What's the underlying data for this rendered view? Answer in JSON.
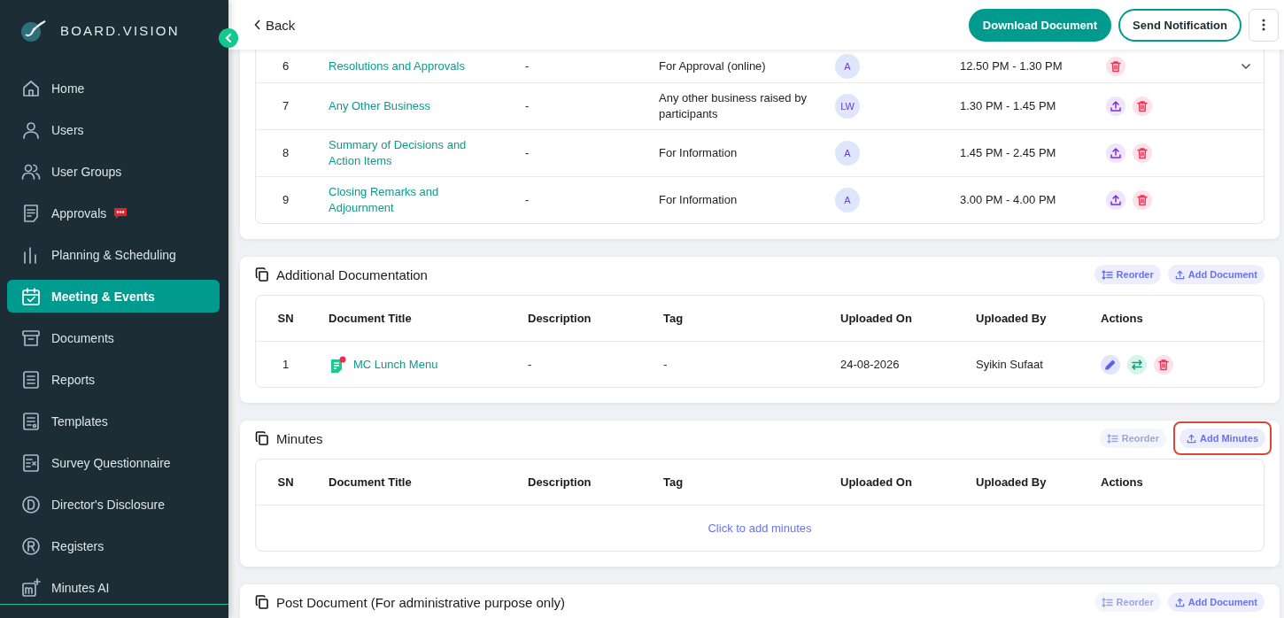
{
  "sidebar": {
    "brand": "BOARD.VISION",
    "items": [
      {
        "label": "Home",
        "kind": "home",
        "selected": false,
        "badge": false
      },
      {
        "label": "Users",
        "kind": "user",
        "selected": false,
        "badge": false
      },
      {
        "label": "User Groups",
        "kind": "users",
        "selected": false,
        "badge": false
      },
      {
        "label": "Approvals",
        "kind": "doc",
        "selected": false,
        "badge": true
      },
      {
        "label": "Planning & Scheduling",
        "kind": "bars",
        "selected": false,
        "badge": false
      },
      {
        "label": "Meeting & Events",
        "kind": "calendar",
        "selected": true,
        "badge": false
      },
      {
        "label": "Documents",
        "kind": "archive",
        "selected": false,
        "badge": false
      },
      {
        "label": "Reports",
        "kind": "list",
        "selected": false,
        "badge": false
      },
      {
        "label": "Templates",
        "kind": "template",
        "selected": false,
        "badge": false
      },
      {
        "label": "Survey Questionnaire",
        "kind": "survey",
        "selected": false,
        "badge": false
      },
      {
        "label": "Director's Disclosure",
        "kind": "circle-d",
        "selected": false,
        "badge": false
      },
      {
        "label": "Registers",
        "kind": "circle-r",
        "selected": false,
        "badge": false
      },
      {
        "label": "Minutes AI",
        "kind": "ai",
        "selected": false,
        "badge": false
      }
    ]
  },
  "header": {
    "back": "Back",
    "buttons": [
      {
        "label": "Download Document",
        "kind": "primary"
      },
      {
        "label": "Send Notification",
        "kind": "outline"
      }
    ]
  },
  "agenda": {
    "rows": [
      {
        "sn": "6",
        "title": "Resolutions and Approvals",
        "presenter": "-",
        "purpose": "For Approval (online)",
        "avatar": "A",
        "time": "12.50 PM - 1.30 PM",
        "actions": [
          {
            "kind": "delete"
          }
        ],
        "expandable": true
      },
      {
        "sn": "7",
        "title": "Any Other Business",
        "presenter": "-",
        "purpose": "Any other business raised by participants",
        "avatar": "LW",
        "time": "1.30 PM - 1.45 PM",
        "actions": [
          {
            "kind": "upload"
          },
          {
            "kind": "delete"
          }
        ],
        "expandable": false
      },
      {
        "sn": "8",
        "title": "Summary of Decisions and Action Items",
        "presenter": "-",
        "purpose": "For Information",
        "avatar": "A",
        "time": "1.45 PM - 2.45 PM",
        "actions": [
          {
            "kind": "upload"
          },
          {
            "kind": "delete"
          }
        ],
        "expandable": false
      },
      {
        "sn": "9",
        "title": "Closing Remarks and Adjournment",
        "presenter": "-",
        "purpose": "For Information",
        "avatar": "A",
        "time": "3.00 PM - 4.00 PM",
        "actions": [
          {
            "kind": "upload"
          },
          {
            "kind": "delete"
          }
        ],
        "expandable": false
      }
    ]
  },
  "sections": [
    {
      "title": "Additional Documentation",
      "buttons": [
        {
          "label": "Reorder",
          "kind": "reorder",
          "disabled": false,
          "highlighted": false
        },
        {
          "label": "Add Document",
          "kind": "add",
          "disabled": false,
          "highlighted": false
        }
      ],
      "columns": [
        "SN",
        "Document Title",
        "Description",
        "Tag",
        "Uploaded On",
        "Uploaded By",
        "Actions"
      ],
      "rows": [
        {
          "sn": "1",
          "title": "MC Lunch Menu",
          "description": "-",
          "tag": "-",
          "uploaded_on": "24-08-2026",
          "uploaded_by": "Syikin Sufaat",
          "unread": true,
          "actions": [
            {
              "kind": "edit"
            },
            {
              "kind": "swap"
            },
            {
              "kind": "delete"
            }
          ]
        }
      ]
    },
    {
      "title": "Minutes",
      "buttons": [
        {
          "label": "Reorder",
          "kind": "reorder",
          "disabled": true,
          "highlighted": false
        },
        {
          "label": "Add Minutes",
          "kind": "add",
          "disabled": false,
          "highlighted": true
        }
      ],
      "columns": [
        "SN",
        "Document Title",
        "Description",
        "Tag",
        "Uploaded On",
        "Uploaded By",
        "Actions"
      ],
      "empty_text": "Click to add minutes"
    },
    {
      "title": "Post Document (For administrative purpose only)",
      "buttons": [
        {
          "label": "Reorder",
          "kind": "reorder",
          "disabled": true,
          "highlighted": false
        },
        {
          "label": "Add Document",
          "kind": "add",
          "disabled": false,
          "highlighted": false
        }
      ]
    }
  ]
}
